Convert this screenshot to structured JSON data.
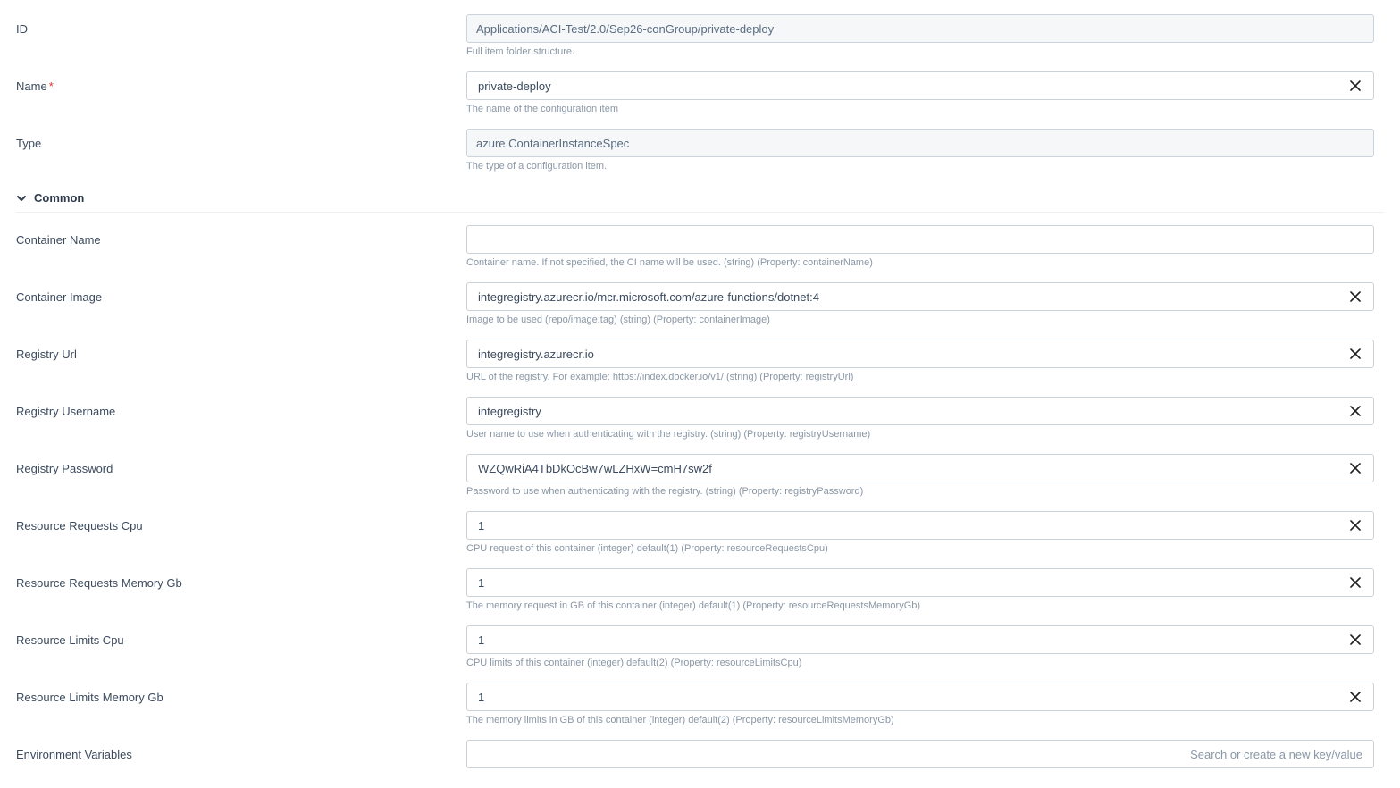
{
  "labels": {
    "id": "ID",
    "name": "Name",
    "type": "Type",
    "common": "Common",
    "containerName": "Container Name",
    "containerImage": "Container Image",
    "registryUrl": "Registry Url",
    "registryUsername": "Registry Username",
    "registryPassword": "Registry Password",
    "reqCpu": "Resource Requests Cpu",
    "reqMem": "Resource Requests Memory Gb",
    "limCpu": "Resource Limits Cpu",
    "limMem": "Resource Limits Memory Gb",
    "envVars": "Environment Variables"
  },
  "values": {
    "id": "Applications/ACI-Test/2.0/Sep26-conGroup/private-deploy",
    "name": "private-deploy",
    "type": "azure.ContainerInstanceSpec",
    "containerName": "",
    "containerImage": "integregistry.azurecr.io/mcr.microsoft.com/azure-functions/dotnet:4",
    "registryUrl": "integregistry.azurecr.io",
    "registryUsername": "integregistry",
    "registryPassword": "WZQwRiA4TbDkOcBw7wLZHxW=cmH7sw2f",
    "reqCpu": "1",
    "reqMem": "1",
    "limCpu": "1",
    "limMem": "1"
  },
  "placeholders": {
    "envVars": "Search or create a new key/value"
  },
  "hints": {
    "id": "Full item folder structure.",
    "name": "The name of the configuration item",
    "type": "The type of a configuration item.",
    "containerName": "Container name. If not specified, the CI name will be used. (string) (Property: containerName)",
    "containerImage": "Image to be used (repo/image:tag) (string) (Property: containerImage)",
    "registryUrl": "URL of the registry. For example: https://index.docker.io/v1/ (string) (Property: registryUrl)",
    "registryUsername": "User name to use when authenticating with the registry. (string) (Property: registryUsername)",
    "registryPassword": "Password to use when authenticating with the registry. (string) (Property: registryPassword)",
    "reqCpu": "CPU request of this container (integer) default(1) (Property: resourceRequestsCpu)",
    "reqMem": "The memory request in GB of this container (integer) default(1) (Property: resourceRequestsMemoryGb)",
    "limCpu": "CPU limits of this container (integer) default(2) (Property: resourceLimitsCpu)",
    "limMem": "The memory limits in GB of this container (integer) default(2) (Property: resourceLimitsMemoryGb)"
  }
}
